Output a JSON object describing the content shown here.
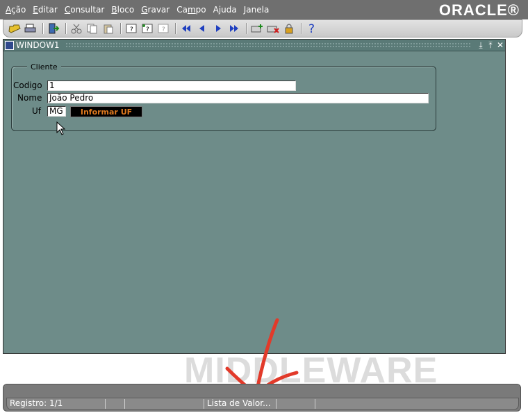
{
  "menubar": {
    "items": [
      {
        "pre": "",
        "u": "A",
        "post": "ção"
      },
      {
        "pre": "",
        "u": "E",
        "post": "ditar"
      },
      {
        "pre": "",
        "u": "C",
        "post": "onsultar"
      },
      {
        "pre": "",
        "u": "B",
        "post": "loco"
      },
      {
        "pre": "",
        "u": "G",
        "post": "ravar"
      },
      {
        "pre": "Ca",
        "u": "m",
        "post": "po"
      },
      {
        "pre": "",
        "u": "",
        "post": "Ajuda"
      },
      {
        "pre": "",
        "u": "",
        "post": "Janela"
      }
    ],
    "logo": "ORACLE®"
  },
  "toolbar": {
    "icons": [
      "open-folder-icon",
      "print-icon",
      "exit-icon",
      "cut-icon",
      "copy-icon",
      "paste-icon",
      "query-enter-icon",
      "query-execute-icon",
      "query-count-icon",
      "first-record-icon",
      "previous-record-icon",
      "next-record-icon",
      "last-record-icon",
      "insert-record-icon",
      "delete-record-icon",
      "lock-record-icon",
      "help-icon"
    ]
  },
  "window": {
    "title": "WINDOW1"
  },
  "form": {
    "group_title": "Cliente",
    "codigo_label": "Codigo",
    "codigo_value": "1",
    "nome_label": "Nome",
    "nome_value": "João Pedro",
    "uf_label": "Uf",
    "uf_value": "MG",
    "uf_button": "Informar UF"
  },
  "watermark": "MIDDLEWARE",
  "status": {
    "record": "Registro: 1/1",
    "message": "Lista de Valor..."
  },
  "colors": {
    "canvas": "#6e8c89",
    "button_text": "#e07a1f",
    "arrow": "#e23a2a"
  }
}
